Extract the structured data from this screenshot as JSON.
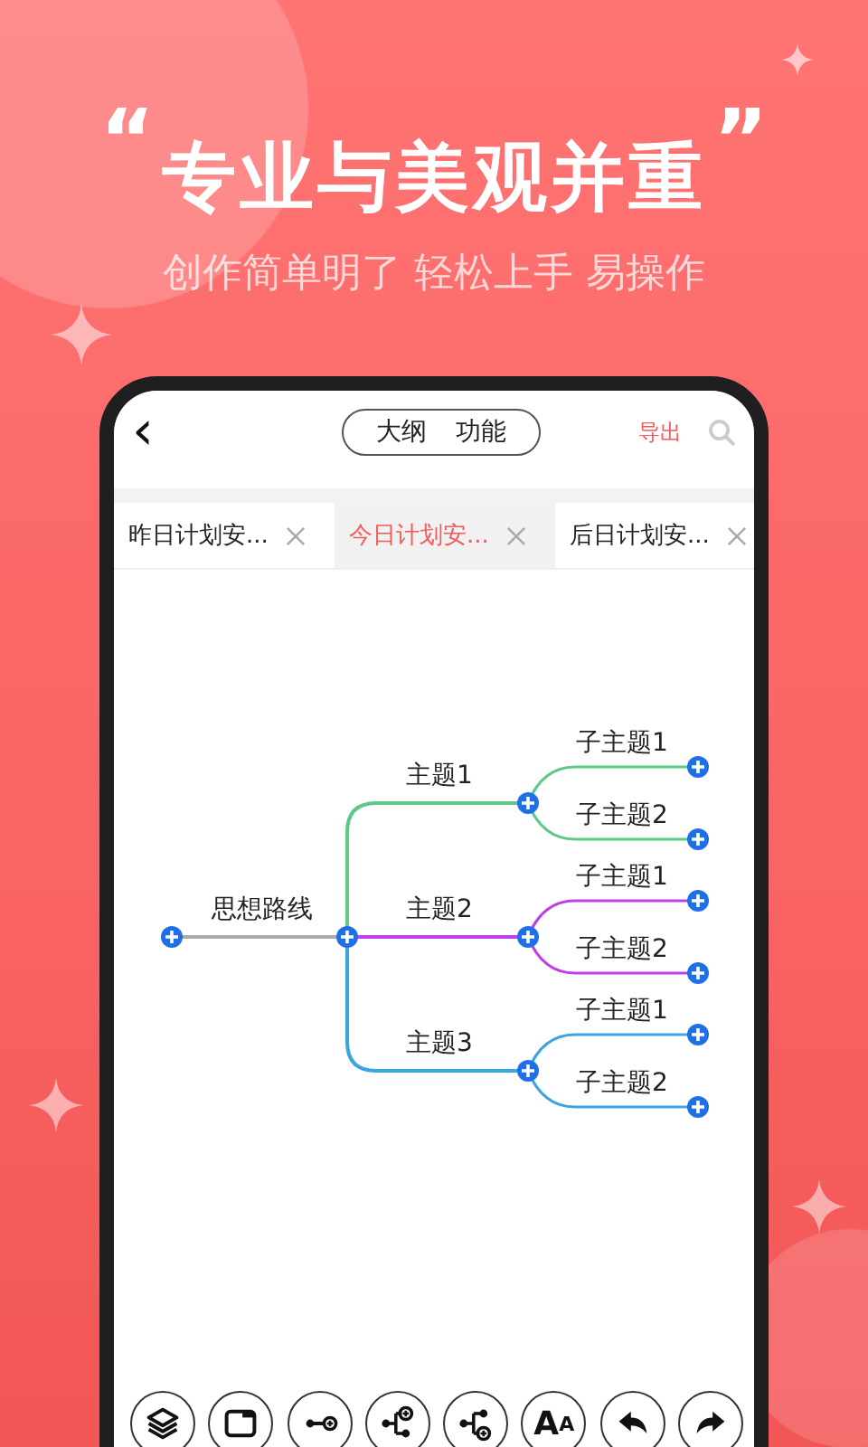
{
  "headline": {
    "open_quote": "“",
    "text": "专业与美观并重",
    "close_quote": "”"
  },
  "subtitle": "创作简单明了 轻松上手 易操作",
  "header": {
    "back": "‹",
    "options": [
      "大纲",
      "功能"
    ],
    "export": "导出"
  },
  "tabs": [
    {
      "label": "昨日计划安...",
      "selected": false
    },
    {
      "label": "今日计划安...",
      "selected": true
    },
    {
      "label": "后日计划安...",
      "selected": false
    }
  ],
  "mindmap": {
    "label": "思想路线",
    "children": [
      {
        "label": "主题1",
        "color": "#5cc98a",
        "children": [
          {
            "label": "子主题1"
          },
          {
            "label": "子主题2"
          }
        ]
      },
      {
        "label": "主题2",
        "color": "#c040e8",
        "children": [
          {
            "label": "子主题1"
          },
          {
            "label": "子主题2"
          }
        ]
      },
      {
        "label": "主题3",
        "color": "#3aa5e0",
        "children": [
          {
            "label": "子主题1"
          },
          {
            "label": "子主题2"
          }
        ]
      }
    ]
  },
  "toolbar": [
    {
      "kind": "layers"
    },
    {
      "kind": "window"
    },
    {
      "kind": "connect"
    },
    {
      "kind": "add-child"
    },
    {
      "kind": "add-sibling"
    },
    {
      "kind": "font",
      "label": "AA"
    },
    {
      "kind": "undo"
    },
    {
      "kind": "redo"
    }
  ]
}
